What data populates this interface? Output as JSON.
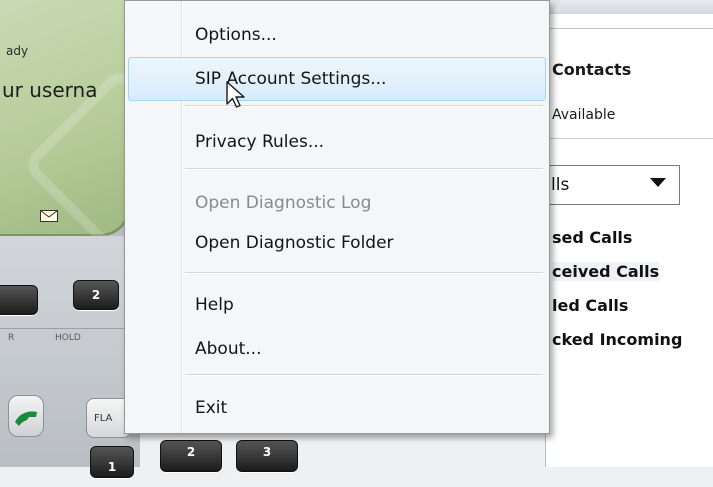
{
  "phone": {
    "status_text": "ady",
    "username_text": "ur userna",
    "key_left_label": "",
    "key_2_label": "2",
    "softkey_r": "R",
    "softkey_hold": "HOLD",
    "flash_label": "FLA",
    "key_1_label": "1",
    "key_2b_label": "2",
    "key_3_label": "3",
    "mail_icon": "envelope-icon",
    "call_icon": "phone-handset-icon",
    "screen_color": "#c2d6ab"
  },
  "contacts_panel": {
    "title": "Contacts",
    "availability": "Available",
    "calls_select_value": "lls",
    "calls_select_icon": "dropdown-arrow-icon",
    "call_items": [
      "sed Calls",
      "ceived Calls",
      "led Calls",
      "cked Incoming"
    ]
  },
  "menu": {
    "items": [
      {
        "label": "Options...",
        "enabled": true
      },
      {
        "label": "SIP Account Settings...",
        "enabled": true,
        "hovered": true
      },
      {
        "label": "Privacy Rules...",
        "enabled": true
      },
      {
        "label": "Open Diagnostic Log",
        "enabled": false
      },
      {
        "label": "Open Diagnostic Folder",
        "enabled": true
      },
      {
        "label": "Help",
        "enabled": true
      },
      {
        "label": "About...",
        "enabled": true
      },
      {
        "label": "Exit",
        "enabled": true
      }
    ],
    "hover_color": "#d8ebfb",
    "disabled_color": "#8a8a8a"
  },
  "cursor": {
    "icon": "mouse-pointer-icon"
  }
}
